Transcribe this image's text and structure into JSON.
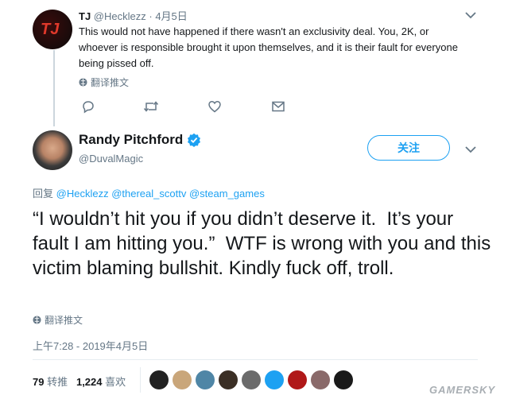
{
  "reply_tweet": {
    "display_name": "TJ",
    "handle": "@Hecklezz",
    "dot": "·",
    "date": "4月5日",
    "text": "This would not have happened if there wasn't an exclusivity deal. You, 2K, or whoever is responsible brought it upon themselves, and it is their fault for everyone being pissed off.",
    "translate_label": "翻译推文",
    "avatar_text": "TJ"
  },
  "main_tweet": {
    "display_name": "Randy Pitchford",
    "handle": "@DuvalMagic",
    "follow_label": "关注",
    "reply_prefix": "回复",
    "reply_mentions": [
      "@Hecklezz",
      "@thereal_scottv",
      "@steam_games"
    ],
    "text": "“I wouldn’t hit you if you didn’t deserve it.  It’s your fault I am hitting you.”  WTF is wrong with you and this victim blaming bullshit. Kindly fuck off, troll.",
    "translate_label": "翻译推文",
    "timestamp": "上午7:28 - 2019年4月5日",
    "retweet_count": "79",
    "retweet_label": "转推",
    "like_count": "1,224",
    "like_label": "喜欢"
  },
  "watermark": "GAMERSKY",
  "colors": {
    "accent": "#1da1f2",
    "muted": "#657786",
    "divider": "#e6ecf0"
  }
}
